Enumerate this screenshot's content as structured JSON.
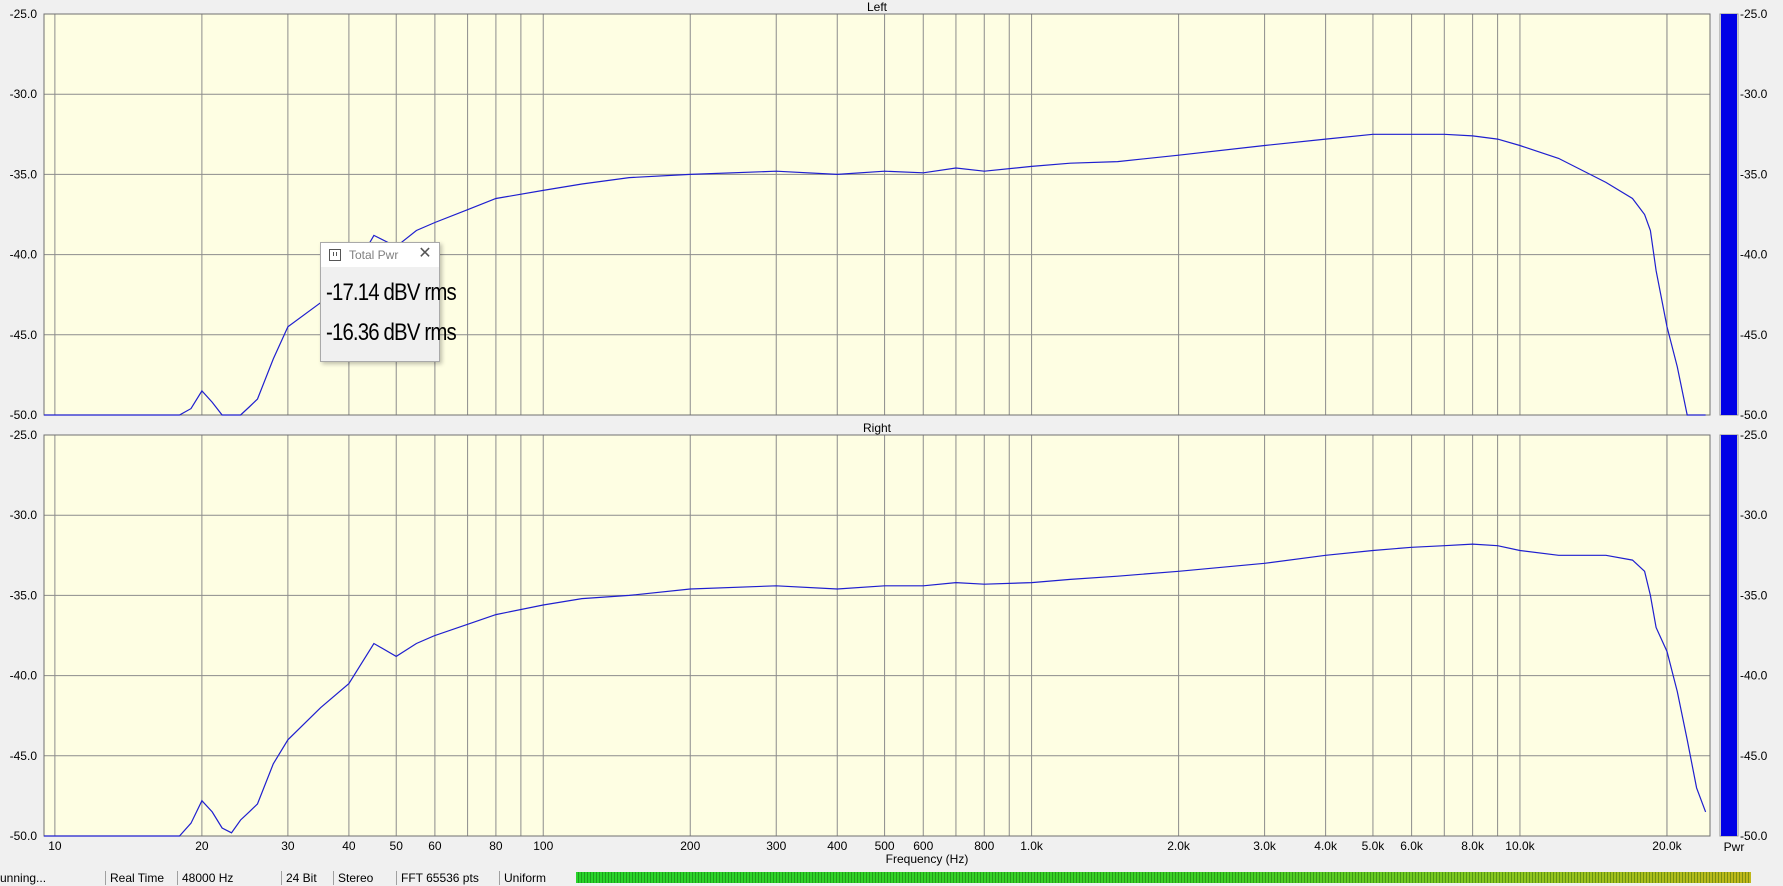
{
  "chart_data": [
    {
      "type": "line",
      "title": "Left",
      "xlabel": "Frequency (Hz)",
      "ylabel": "",
      "xscale": "log",
      "xlim": [
        9.5,
        24500
      ],
      "ylim": [
        -50,
        -25
      ],
      "grid": true,
      "y_ticks": [
        "-25.0",
        "-30.0",
        "-35.0",
        "-40.0",
        "-45.0",
        "-50.0"
      ],
      "x_tick_labels": [
        "10",
        "20",
        "30",
        "40",
        "50",
        "60",
        "80",
        "100",
        "200",
        "300",
        "400",
        "500",
        "600",
        "800",
        "1.0k",
        "2.0k",
        "3.0k",
        "4.0k",
        "5.0k",
        "6.0k",
        "8.0k",
        "10.0k",
        "20.0k"
      ],
      "x_tick_values": [
        10,
        20,
        30,
        40,
        50,
        60,
        80,
        100,
        200,
        300,
        400,
        500,
        600,
        800,
        1000,
        2000,
        3000,
        4000,
        5000,
        6000,
        8000,
        10000,
        20000
      ],
      "series": [
        {
          "x": [
            9.5,
            18,
            19,
            20,
            21,
            22,
            23,
            24,
            25,
            26,
            28,
            30,
            35,
            40,
            45,
            50,
            55,
            60,
            70,
            80,
            100,
            120,
            150,
            200,
            300,
            400,
            500,
            600,
            700,
            800,
            1000,
            1200,
            1500,
            2000,
            3000,
            4000,
            5000,
            6000,
            7000,
            8000,
            9000,
            10000,
            12000,
            15000,
            17000,
            18000,
            18500,
            19000,
            20000,
            21000,
            22000,
            24000
          ],
          "y": [
            -50,
            -50,
            -49.6,
            -48.5,
            -49.2,
            -50,
            -50,
            -50,
            -49.5,
            -49,
            -46.5,
            -44.5,
            -43,
            -41.5,
            -38.8,
            -39.5,
            -38.5,
            -38,
            -37.2,
            -36.5,
            -36,
            -35.6,
            -35.2,
            -35,
            -34.8,
            -35,
            -34.8,
            -34.9,
            -34.6,
            -34.8,
            -34.5,
            -34.3,
            -34.2,
            -33.8,
            -33.2,
            -32.8,
            -32.5,
            -32.5,
            -32.5,
            -32.6,
            -32.8,
            -33.2,
            -34,
            -35.5,
            -36.5,
            -37.5,
            -38.5,
            -41,
            -44.5,
            -47,
            -50,
            -50
          ]
        }
      ]
    },
    {
      "type": "line",
      "title": "Right",
      "xlabel": "Frequency (Hz)",
      "ylabel": "",
      "xscale": "log",
      "xlim": [
        9.5,
        24500
      ],
      "ylim": [
        -50,
        -25
      ],
      "grid": true,
      "y_ticks": [
        "-25.0",
        "-30.0",
        "-35.0",
        "-40.0",
        "-45.0",
        "-50.0"
      ],
      "x_tick_labels": [
        "10",
        "20",
        "30",
        "40",
        "50",
        "60",
        "80",
        "100",
        "200",
        "300",
        "400",
        "500",
        "600",
        "800",
        "1.0k",
        "2.0k",
        "3.0k",
        "4.0k",
        "5.0k",
        "6.0k",
        "8.0k",
        "10.0k",
        "20.0k"
      ],
      "x_tick_values": [
        10,
        20,
        30,
        40,
        50,
        60,
        80,
        100,
        200,
        300,
        400,
        500,
        600,
        800,
        1000,
        2000,
        3000,
        4000,
        5000,
        6000,
        8000,
        10000,
        20000
      ],
      "series": [
        {
          "x": [
            9.5,
            18,
            19,
            20,
            21,
            22,
            23,
            24,
            25,
            26,
            28,
            30,
            35,
            40,
            45,
            50,
            55,
            60,
            70,
            80,
            100,
            120,
            150,
            200,
            300,
            400,
            500,
            600,
            700,
            800,
            1000,
            1200,
            1500,
            2000,
            3000,
            4000,
            5000,
            6000,
            7000,
            8000,
            9000,
            10000,
            12000,
            15000,
            17000,
            18000,
            18500,
            19000,
            20000,
            21000,
            22000,
            23000,
            24000
          ],
          "y": [
            -50,
            -50,
            -49.2,
            -47.8,
            -48.5,
            -49.5,
            -49.8,
            -49,
            -48.5,
            -48,
            -45.5,
            -44,
            -42,
            -40.5,
            -38,
            -38.8,
            -38,
            -37.5,
            -36.8,
            -36.2,
            -35.6,
            -35.2,
            -35,
            -34.6,
            -34.4,
            -34.6,
            -34.4,
            -34.4,
            -34.2,
            -34.3,
            -34.2,
            -34,
            -33.8,
            -33.5,
            -33,
            -32.5,
            -32.2,
            -32,
            -31.9,
            -31.8,
            -31.9,
            -32.2,
            -32.5,
            -32.5,
            -32.8,
            -33.5,
            -35,
            -37,
            -38.5,
            -41,
            -44,
            -47,
            -48.5
          ]
        }
      ]
    }
  ],
  "meters": {
    "label": "Pwr",
    "levels": [
      1.0,
      1.0
    ]
  },
  "popup": {
    "title": "Total Pwr",
    "value_left": "-17.14 dBV rms",
    "value_right": "-16.36 dBV rms"
  },
  "statusbar": {
    "state": "unning...",
    "mode": "Real Time",
    "sample_rate": "48000 Hz",
    "bit_depth": "24 Bit",
    "channels": "Stereo",
    "fft": "FFT 65536 pts",
    "window": "Uniform"
  },
  "colors": {
    "plot_bg": "#fefee3",
    "grid": "#8c8c8c",
    "trace": "#1f1fcf",
    "meter_fill": "#0000e6"
  }
}
